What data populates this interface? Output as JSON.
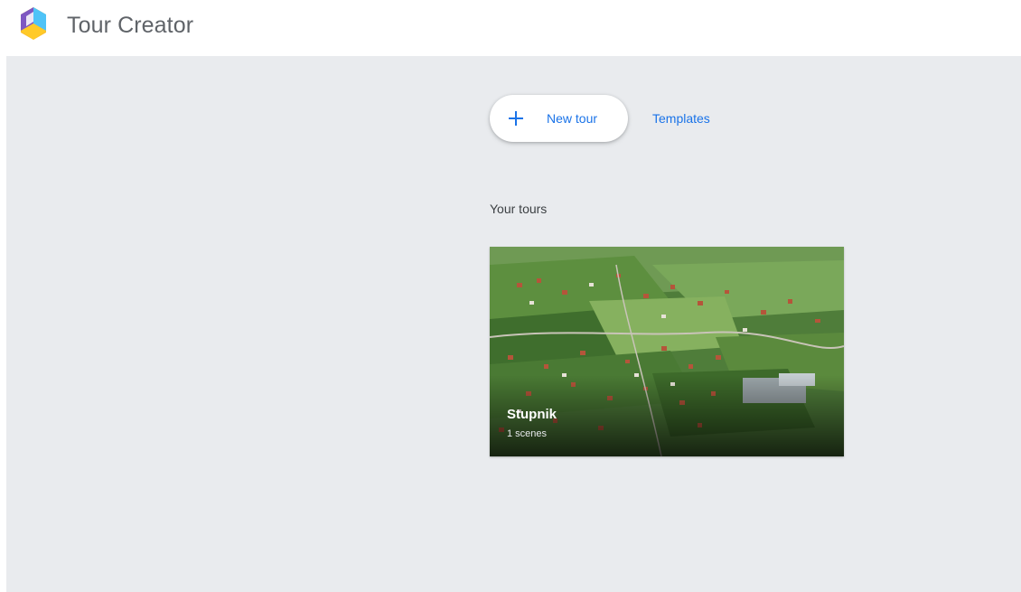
{
  "header": {
    "app_title": "Tour Creator",
    "logo_icon": "tour-creator-logo-icon"
  },
  "actions": {
    "new_tour_label": "New tour",
    "new_tour_icon": "plus-icon",
    "templates_label": "Templates"
  },
  "tours_section": {
    "title": "Your tours",
    "tours": [
      {
        "name": "Stupnik",
        "scenes": "1 scenes",
        "thumbnail": "aerial-village-photo"
      }
    ]
  },
  "colors": {
    "accent": "#1a73e8",
    "background": "#e9ebee",
    "header": "#ffffff"
  }
}
